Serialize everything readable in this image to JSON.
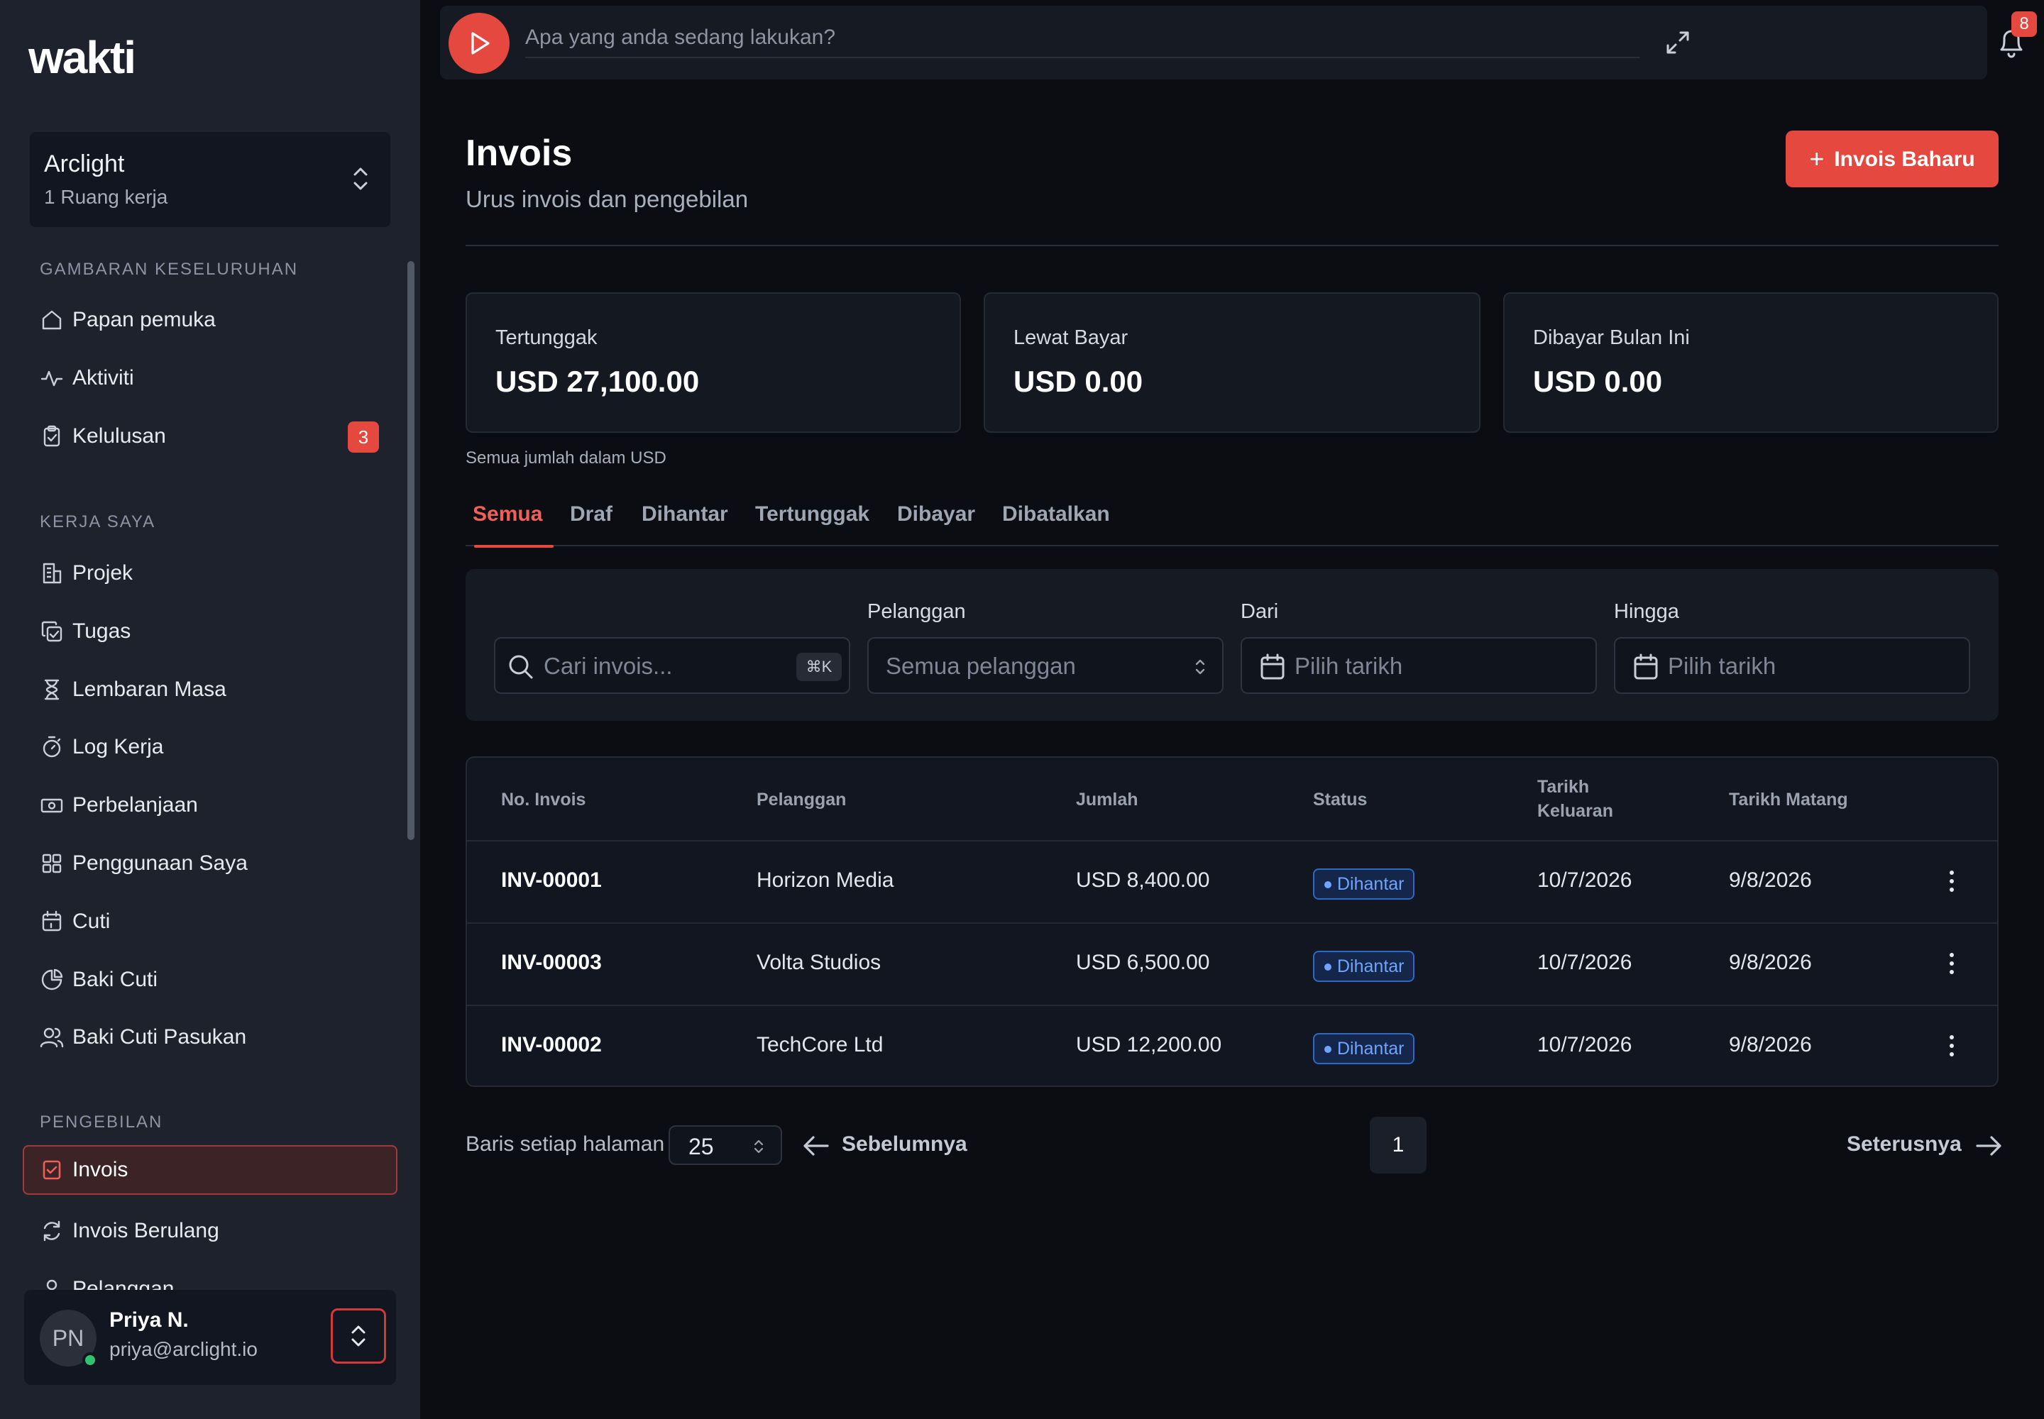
{
  "app": {
    "logo": "wakti"
  },
  "workspace": {
    "name": "Arclight",
    "sub": "1 Ruang kerja"
  },
  "sidebar": {
    "sections": [
      {
        "title": "GAMBARAN KESELURUHAN"
      },
      {
        "title": "KERJA SAYA"
      },
      {
        "title": "PENGEBILAN"
      }
    ],
    "items": [
      {
        "label": "Papan pemuka",
        "icon": "home-icon"
      },
      {
        "label": "Aktiviti",
        "icon": "activity-icon"
      },
      {
        "label": "Kelulusan",
        "icon": "clipboard-check-icon",
        "badge": "3"
      },
      {
        "label": "Projek",
        "icon": "building-icon"
      },
      {
        "label": "Tugas",
        "icon": "copy-check-icon"
      },
      {
        "label": "Lembaran Masa",
        "icon": "hourglass-icon"
      },
      {
        "label": "Log Kerja",
        "icon": "timer-icon"
      },
      {
        "label": "Perbelanjaan",
        "icon": "banknote-icon"
      },
      {
        "label": "Penggunaan Saya",
        "icon": "grid-icon"
      },
      {
        "label": "Cuti",
        "icon": "calendar-icon"
      },
      {
        "label": "Baki Cuti",
        "icon": "pie-chart-icon"
      },
      {
        "label": "Baki Cuti Pasukan",
        "icon": "users-icon"
      },
      {
        "label": "Invois",
        "icon": "invoice-icon",
        "active": true
      },
      {
        "label": "Invois Berulang",
        "icon": "refresh-icon"
      },
      {
        "label": "Pelanggan",
        "icon": "user-icon"
      }
    ]
  },
  "user": {
    "initials": "PN",
    "name": "Priya N.",
    "email": "priya@arclight.io"
  },
  "topbar": {
    "placeholder": "Apa yang anda sedang lakukan?",
    "notifications": "8"
  },
  "page": {
    "title": "Invois",
    "subtitle": "Urus invois dan pengebilan",
    "new_button": "Invois Baharu"
  },
  "summary": {
    "cards": [
      {
        "label": "Tertunggak",
        "value": "USD 27,100.00"
      },
      {
        "label": "Lewat Bayar",
        "value": "USD 0.00"
      },
      {
        "label": "Dibayar Bulan Ini",
        "value": "USD 0.00"
      }
    ],
    "note": "Semua jumlah dalam USD"
  },
  "tabs": [
    "Semua",
    "Draf",
    "Dihantar",
    "Tertunggak",
    "Dibayar",
    "Dibatalkan"
  ],
  "filters": {
    "search_placeholder": "Cari invois...",
    "shortcut": "⌘K",
    "customer_label": "Pelanggan",
    "customer_value": "Semua pelanggan",
    "from_label": "Dari",
    "from_placeholder": "Pilih tarikh",
    "to_label": "Hingga",
    "to_placeholder": "Pilih tarikh"
  },
  "table": {
    "headers": [
      "No. Invois",
      "Pelanggan",
      "Jumlah",
      "Status",
      "Tarikh Keluaran",
      "Tarikh Matang"
    ],
    "rows": [
      {
        "id": "INV-00001",
        "customer": "Horizon Media",
        "amount": "USD 8,400.00",
        "status": "Dihantar",
        "issued": "10/7/2026",
        "due": "9/8/2026"
      },
      {
        "id": "INV-00003",
        "customer": "Volta Studios",
        "amount": "USD 6,500.00",
        "status": "Dihantar",
        "issued": "10/7/2026",
        "due": "9/8/2026"
      },
      {
        "id": "INV-00002",
        "customer": "TechCore Ltd",
        "amount": "USD 12,200.00",
        "status": "Dihantar",
        "issued": "10/7/2026",
        "due": "9/8/2026"
      }
    ]
  },
  "pagination": {
    "rows_label": "Baris setiap halaman",
    "rows_value": "25",
    "prev": "Sebelumnya",
    "page": "1",
    "next": "Seterusnya"
  },
  "colors": {
    "accent": "#e5483f",
    "status_blue": "#6fa4ff",
    "background": "#0b0d12",
    "sidebar": "#1d222d"
  }
}
